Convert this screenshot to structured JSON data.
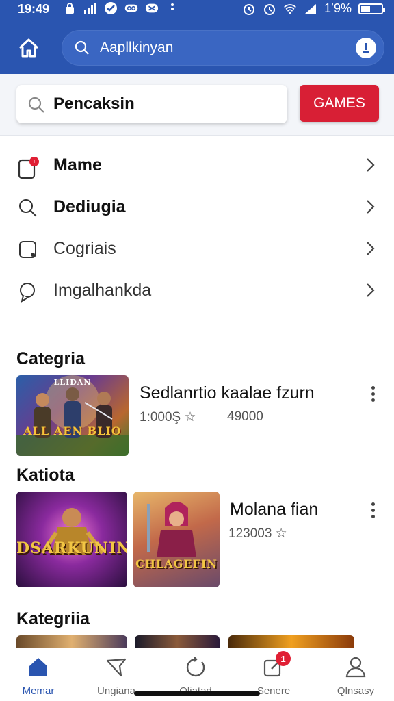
{
  "status_bar": {
    "time": "19:49",
    "battery": "1ʼ9%",
    "battery_level": 0.4
  },
  "header": {
    "address_text": "Aapllkinyan",
    "home_icon": "home-icon",
    "info_icon": "info-icon",
    "color": "#2a55b0"
  },
  "search": {
    "value": "Pencaksin",
    "button_label": "GAMES",
    "button_color": "#d81f35"
  },
  "menu": {
    "items": [
      {
        "label": "Mame",
        "icon": "phone-notification-icon"
      },
      {
        "label": "Dediugia",
        "icon": "search-icon"
      },
      {
        "label": "Cogriais",
        "icon": "square-icon"
      },
      {
        "label": "Imgalhankda",
        "icon": "chat-bubble-icon"
      }
    ]
  },
  "sections": [
    {
      "title": "Categria",
      "items": [
        {
          "thumb_text": "ALL AEN BLIO",
          "thumb_top_text": "LLIDAN",
          "title": "Sedlanrtio kaalae fzurn",
          "meta_left": "1:000Ş ☆",
          "meta_right": "49000"
        }
      ]
    },
    {
      "title": "Katiota",
      "items": [
        {
          "thumb_text": "DSARKUNIN",
          "thumb2_text": "CHLAGEFIN",
          "title": "Molana fian",
          "meta_left": "123003 ☆"
        }
      ]
    },
    {
      "title": "Kategriia"
    }
  ],
  "bottom_nav": {
    "items": [
      {
        "label": "Memar",
        "icon": "home-icon",
        "active": true
      },
      {
        "label": "Ungiana",
        "icon": "tag-icon"
      },
      {
        "label": "Oliatad",
        "icon": "refresh-icon"
      },
      {
        "label": "Senere",
        "icon": "edit-icon",
        "badge": "1"
      },
      {
        "label": "Qlnsasy",
        "icon": "user-icon"
      }
    ],
    "active_color": "#2a55b0"
  }
}
